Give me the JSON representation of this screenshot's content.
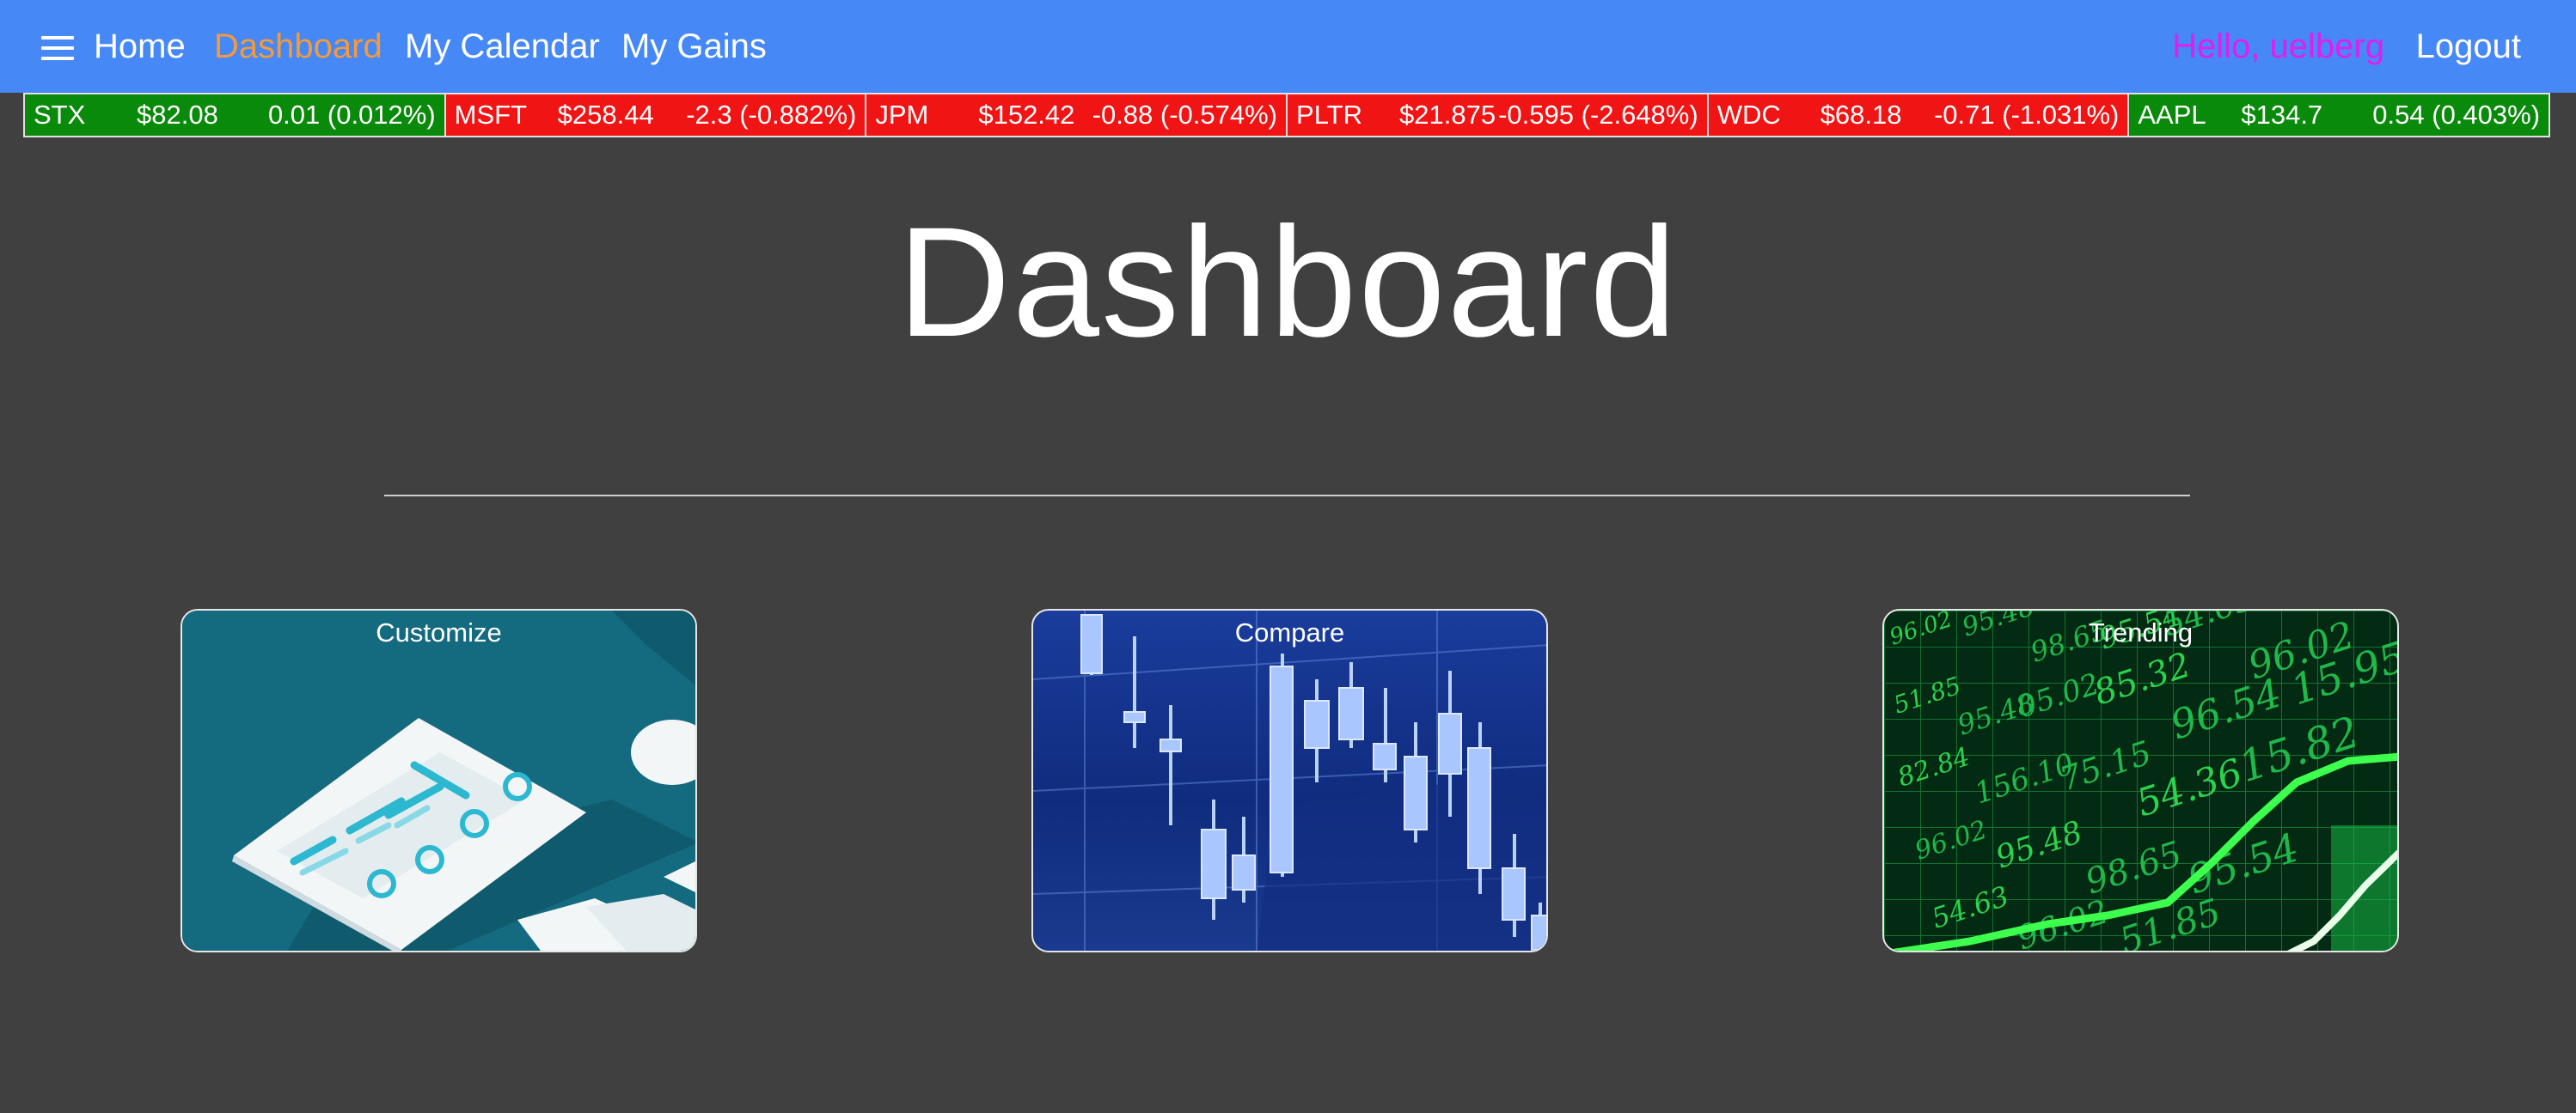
{
  "nav": {
    "home": "Home",
    "dashboard": "Dashboard",
    "calendar": "My Calendar",
    "gains": "My Gains",
    "greeting": "Hello, uelberg",
    "logout": "Logout",
    "menu_icon": "hamburger-menu-icon",
    "active_color": "#f39a3c",
    "greeting_color": "#e11df0",
    "bar_color": "#4688f5"
  },
  "ticker": [
    {
      "symbol": "STX",
      "price": "$82.08",
      "change": "0.01 (0.012%)",
      "direction": "up"
    },
    {
      "symbol": "MSFT",
      "price": "$258.44",
      "change": "-2.3 (-0.882%)",
      "direction": "down"
    },
    {
      "symbol": "JPM",
      "price": "$152.42",
      "change": "-0.88 (-0.574%)",
      "direction": "down"
    },
    {
      "symbol": "PLTR",
      "price": "$21.875",
      "change": "-0.595 (-2.648%)",
      "direction": "down"
    },
    {
      "symbol": "WDC",
      "price": "$68.18",
      "change": "-0.71 (-1.031%)",
      "direction": "down"
    },
    {
      "symbol": "AAPL",
      "price": "$134.7",
      "change": "0.54 (0.403%)",
      "direction": "up"
    }
  ],
  "ticker_colors": {
    "up": "#0a8a0a",
    "down": "#f01414"
  },
  "main": {
    "title": "Dashboard"
  },
  "cards": [
    {
      "label": "Customize"
    },
    {
      "label": "Compare"
    },
    {
      "label": "Trending"
    }
  ],
  "trending_numbers": [
    "96.02",
    "95.48",
    "98.65",
    "95.54",
    "54.63",
    "96.02",
    "51.85",
    "95.48",
    "05.02",
    "85.32",
    "96.54",
    "15.95",
    "82.84",
    "156.10",
    "75.15",
    "54.36",
    "15.82"
  ]
}
